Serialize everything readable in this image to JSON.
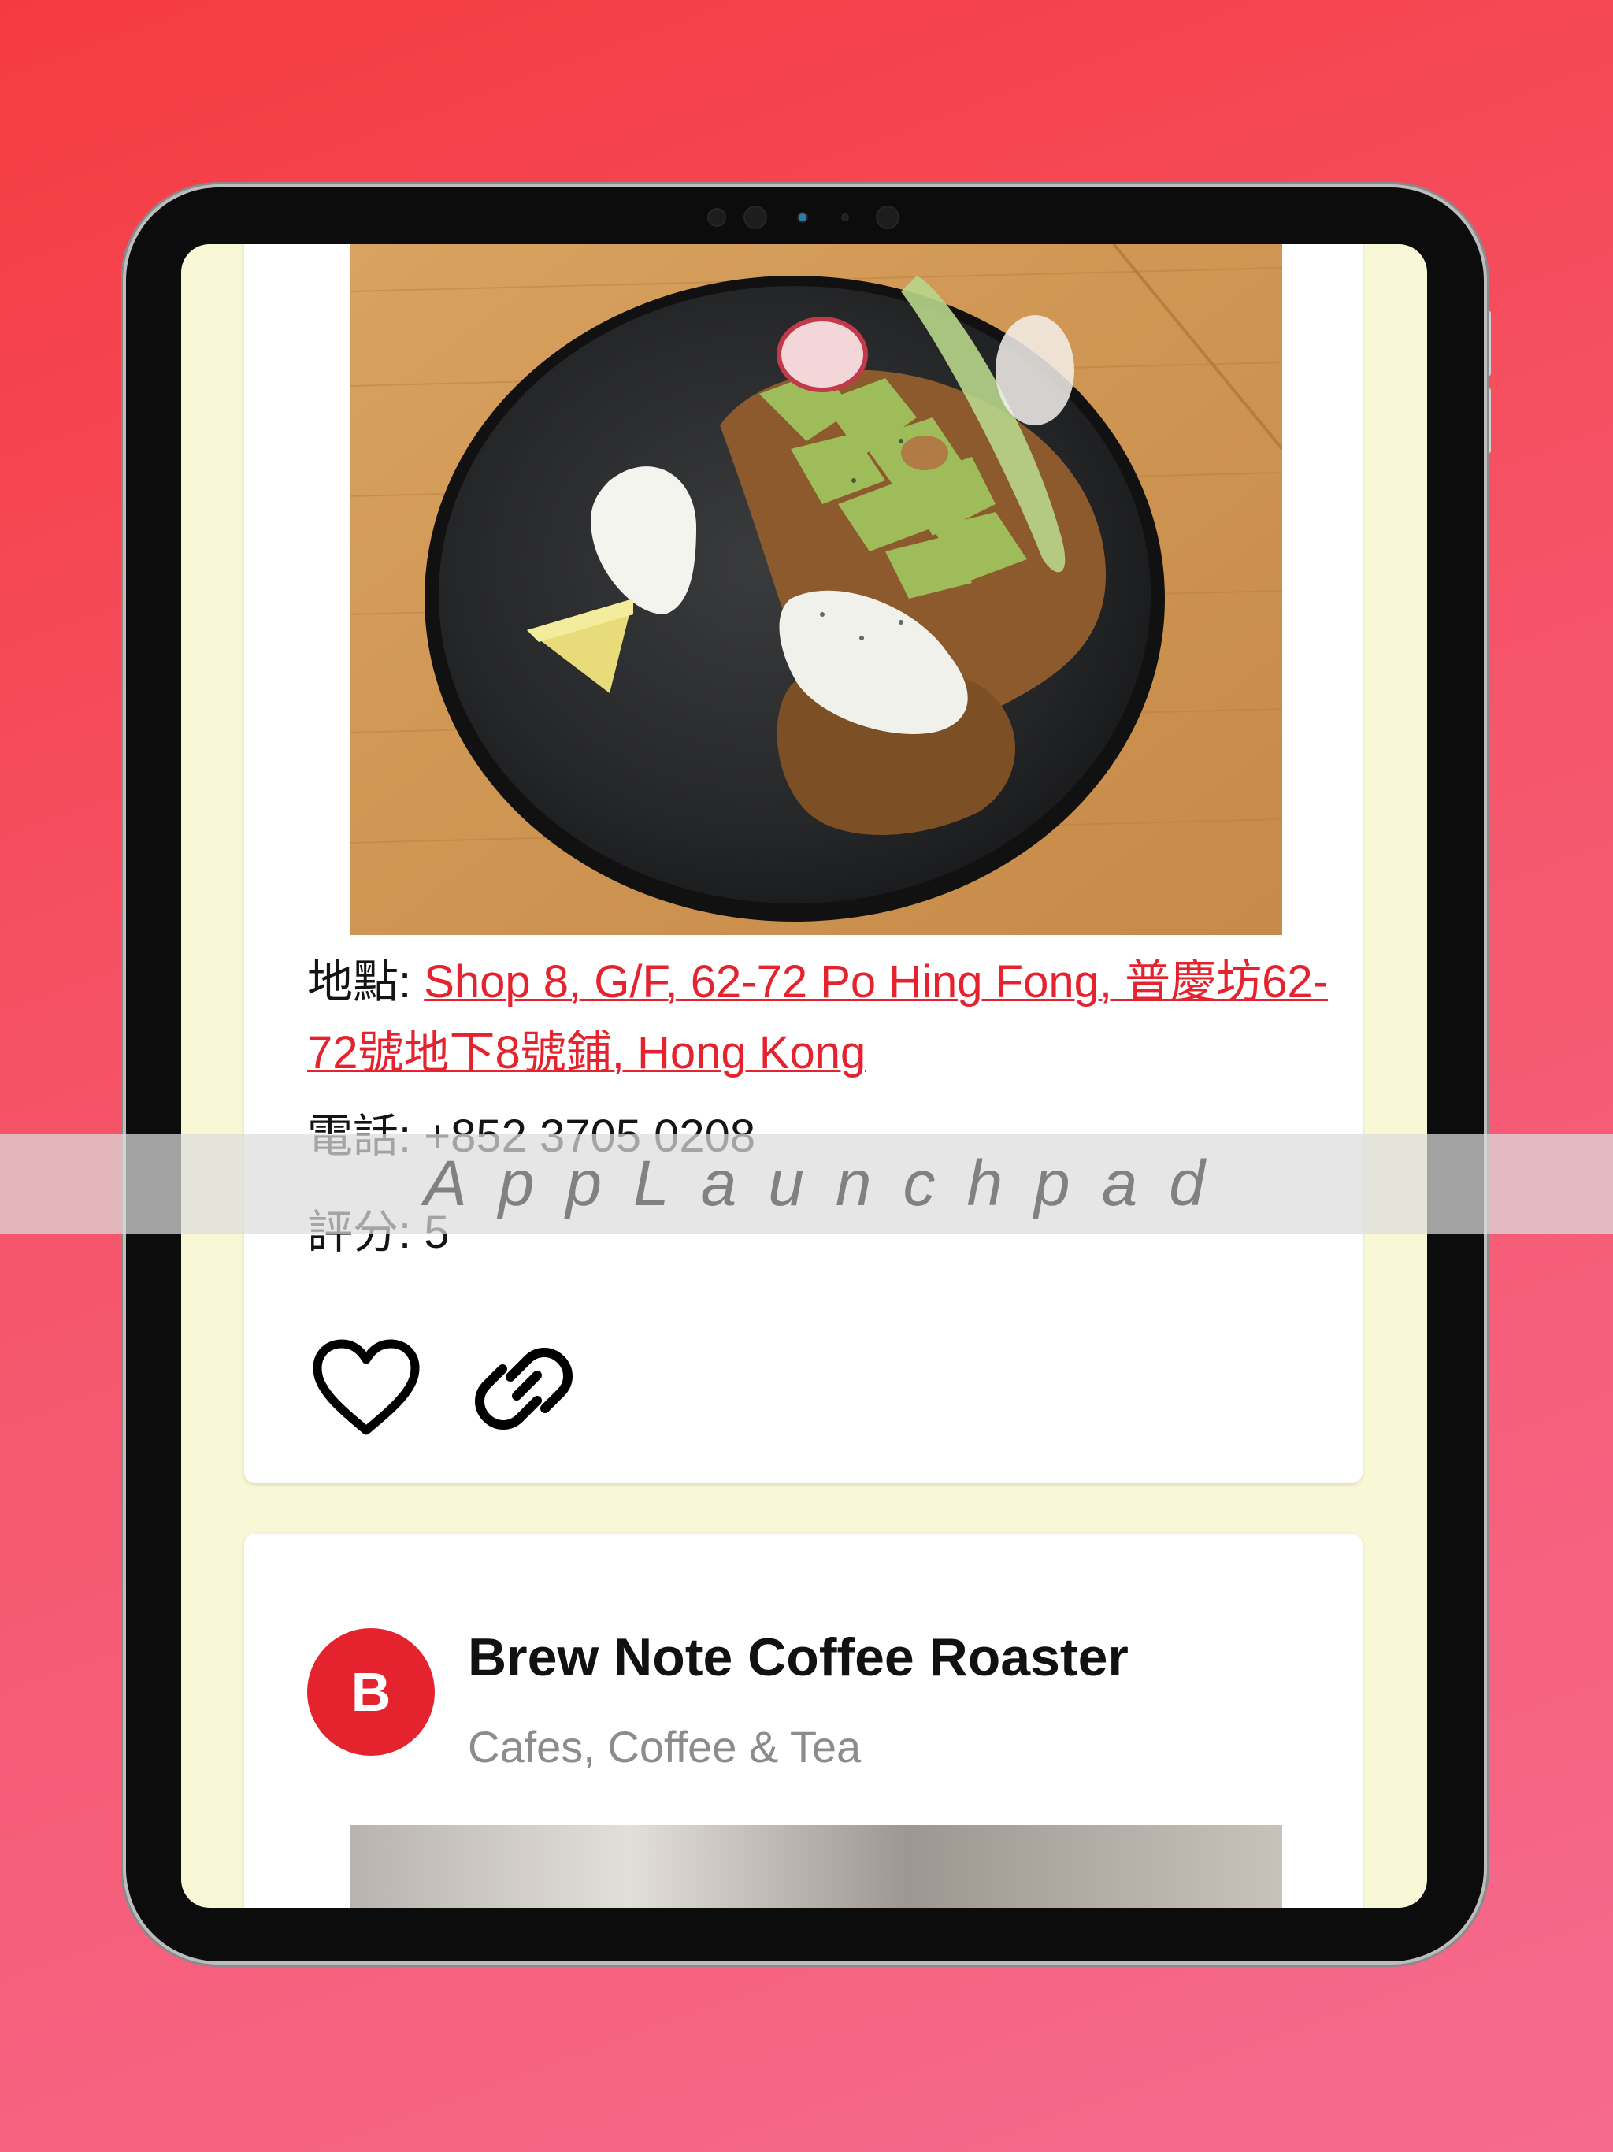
{
  "listing_1": {
    "address_label": "地點: ",
    "address_link": "Shop 8, G/F, 62-72 Po Hing Fong, 普慶坊62-72號地下8號鋪, Hong Kong",
    "phone_label": "電話: ",
    "phone": "+852 3705 0208",
    "rating_label": "評分: ",
    "rating": "5",
    "actions": {
      "favorite_icon": "heart-icon",
      "link_icon": "link-icon"
    }
  },
  "listing_2": {
    "avatar_letter": "B",
    "name": "Brew Note Coffee Roaster",
    "category": "Cafes, Coffee & Tea"
  },
  "watermark": "AppLaunchpad",
  "colors": {
    "accent": "#e5232f",
    "screen_background": "#f8f8d6",
    "background_gradient_start": "#f53b41",
    "background_gradient_end": "#f66a8e"
  }
}
